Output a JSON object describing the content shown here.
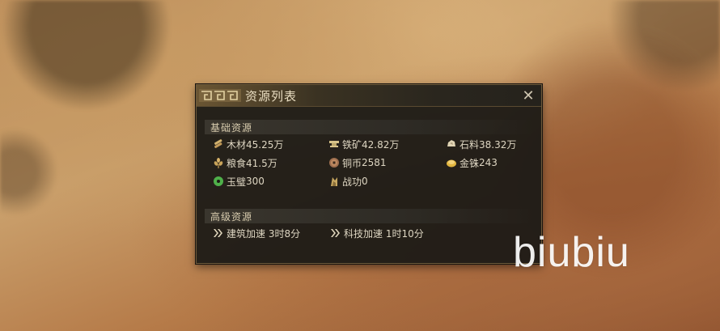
{
  "panel": {
    "title": "资源列表",
    "close_symbol": "✕",
    "basic_section_label": "基础资源",
    "advanced_section_label": "高级资源",
    "basic": [
      {
        "icon": "wood-icon",
        "name": "木材",
        "value": "45.25万"
      },
      {
        "icon": "iron-ore-icon",
        "name": "铁矿",
        "value": "42.82万"
      },
      {
        "icon": "stone-icon",
        "name": "石料",
        "value": "38.32万"
      },
      {
        "icon": "grain-icon",
        "name": "粮食",
        "value": "41.5万"
      },
      {
        "icon": "copper-coin-icon",
        "name": "铜币",
        "value": "2581"
      },
      {
        "icon": "gold-bead-icon",
        "name": "金铢",
        "value": "243"
      },
      {
        "icon": "jade-disc-icon",
        "name": "玉璧",
        "value": "300"
      },
      {
        "icon": "merit-icon",
        "name": "战功",
        "value": "0"
      }
    ],
    "advanced": [
      {
        "icon": "speedup-icon",
        "name": "建筑加速",
        "value": "3时8分"
      },
      {
        "icon": "speedup-icon",
        "name": "科技加速",
        "value": "1时10分"
      }
    ]
  },
  "watermark": "biubiu",
  "colors": {
    "panel_bg": "#1c1a16",
    "text": "#ded6c2",
    "border": "#6e5a3a"
  }
}
